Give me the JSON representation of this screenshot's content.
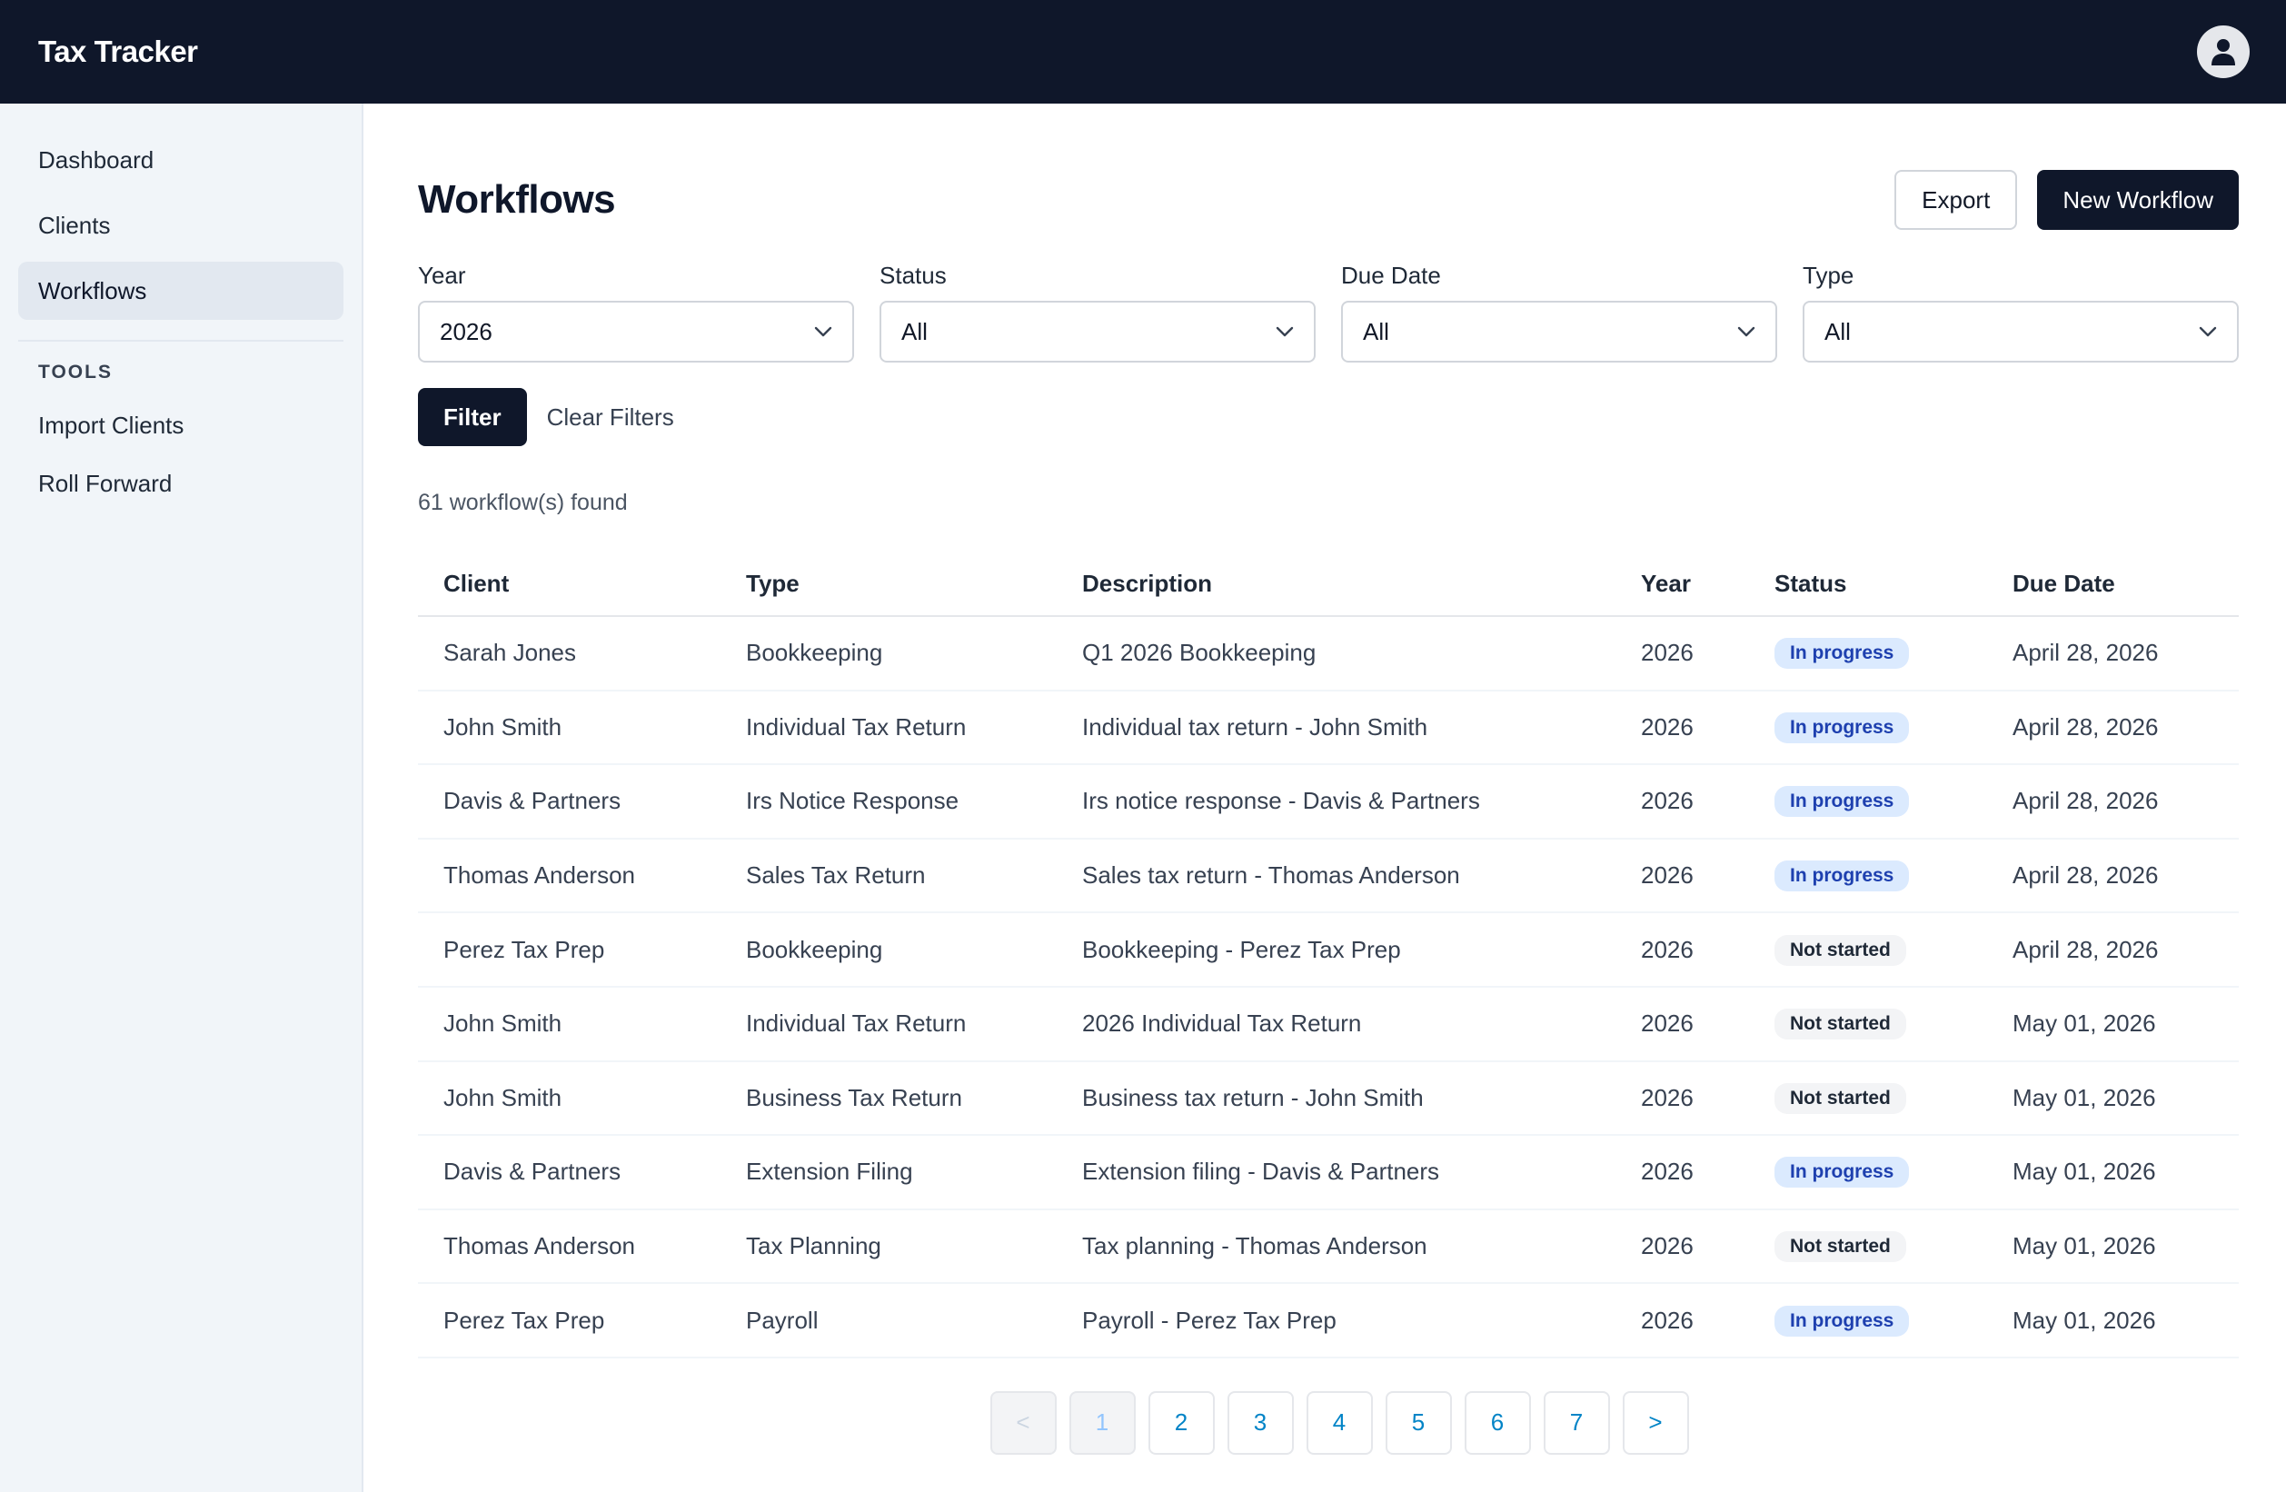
{
  "app": {
    "title": "Tax Tracker"
  },
  "sidebar": {
    "items": [
      {
        "label": "Dashboard"
      },
      {
        "label": "Clients"
      },
      {
        "label": "Workflows"
      }
    ],
    "tools_heading": "TOOLS",
    "tools": [
      {
        "label": "Import Clients"
      },
      {
        "label": "Roll Forward"
      }
    ]
  },
  "page": {
    "title": "Workflows",
    "export_label": "Export",
    "new_label": "New Workflow"
  },
  "filters": {
    "year": {
      "label": "Year",
      "value": "2026"
    },
    "status": {
      "label": "Status",
      "value": "All"
    },
    "due_date": {
      "label": "Due Date",
      "value": "All"
    },
    "type": {
      "label": "Type",
      "value": "All"
    },
    "filter_label": "Filter",
    "clear_label": "Clear Filters"
  },
  "results": {
    "count_text": "61 workflow(s) found"
  },
  "table": {
    "headers": [
      "Client",
      "Type",
      "Description",
      "Year",
      "Status",
      "Due Date"
    ],
    "rows": [
      {
        "client": "Sarah Jones",
        "type": "Bookkeeping",
        "description": "Q1 2026 Bookkeeping",
        "year": "2026",
        "status": "In progress",
        "due": "April 28, 2026"
      },
      {
        "client": "John Smith",
        "type": "Individual Tax Return",
        "description": "Individual tax return - John Smith",
        "year": "2026",
        "status": "In progress",
        "due": "April 28, 2026"
      },
      {
        "client": "Davis & Partners",
        "type": "Irs Notice Response",
        "description": "Irs notice response - Davis & Partners",
        "year": "2026",
        "status": "In progress",
        "due": "April 28, 2026"
      },
      {
        "client": "Thomas Anderson",
        "type": "Sales Tax Return",
        "description": "Sales tax return - Thomas Anderson",
        "year": "2026",
        "status": "In progress",
        "due": "April 28, 2026"
      },
      {
        "client": "Perez Tax Prep",
        "type": "Bookkeeping",
        "description": "Bookkeeping - Perez Tax Prep",
        "year": "2026",
        "status": "Not started",
        "due": "April 28, 2026"
      },
      {
        "client": "John Smith",
        "type": "Individual Tax Return",
        "description": "2026 Individual Tax Return",
        "year": "2026",
        "status": "Not started",
        "due": "May 01, 2026"
      },
      {
        "client": "John Smith",
        "type": "Business Tax Return",
        "description": "Business tax return - John Smith",
        "year": "2026",
        "status": "Not started",
        "due": "May 01, 2026"
      },
      {
        "client": "Davis & Partners",
        "type": "Extension Filing",
        "description": "Extension filing - Davis & Partners",
        "year": "2026",
        "status": "In progress",
        "due": "May 01, 2026"
      },
      {
        "client": "Thomas Anderson",
        "type": "Tax Planning",
        "description": "Tax planning - Thomas Anderson",
        "year": "2026",
        "status": "Not started",
        "due": "May 01, 2026"
      },
      {
        "client": "Perez Tax Prep",
        "type": "Payroll",
        "description": "Payroll - Perez Tax Prep",
        "year": "2026",
        "status": "In progress",
        "due": "May 01, 2026"
      }
    ]
  },
  "pagination": {
    "prev": "<",
    "next": ">",
    "pages": [
      "1",
      "2",
      "3",
      "4",
      "5",
      "6",
      "7"
    ],
    "current": "1"
  },
  "icons": {
    "avatar": "user-icon",
    "select": "chevron-down-icon"
  },
  "colors": {
    "topbar": "#0f172a",
    "in_progress_bg": "#dbeafe",
    "in_progress_text": "#1e40af",
    "not_started_bg": "#f3f4f6",
    "link": "#0284c7"
  }
}
